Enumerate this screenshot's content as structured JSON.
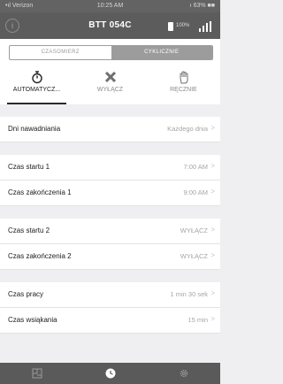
{
  "status_bar": {
    "carrier": "•ıl Verizon",
    "time": "10:25 AM",
    "battery": "ı 63% ■■"
  },
  "nav": {
    "info_symbol": "i",
    "title": "BTT 054C",
    "battery_percent": "100%"
  },
  "segments": {
    "left": "CZASOMIERZ",
    "right": "CYKLICZNIE",
    "selected": "CYKLICZNIE"
  },
  "modes": [
    {
      "label": "AUTOMATYCZ...",
      "icon": "stopwatch-icon",
      "active": true
    },
    {
      "label": "WYŁĄCZ",
      "icon": "x-close-icon",
      "active": false
    },
    {
      "label": "RĘCZNIE",
      "icon": "hand-icon",
      "active": false
    }
  ],
  "settings": {
    "days": {
      "label": "Dni nawadniania",
      "value": "Każdego dnia"
    },
    "start1": {
      "label": "Czas startu 1",
      "value": "7:00 AM"
    },
    "end1": {
      "label": "Czas zakończenia 1",
      "value": "9:00 AM"
    },
    "start2": {
      "label": "Czas startu 2",
      "value": "WYŁĄCZ"
    },
    "end2": {
      "label": "Czas zakończenia 2",
      "value": "WYŁĄCZ"
    },
    "run_time": {
      "label": "Czas pracy",
      "value": "1 min 30 sek"
    },
    "soak_time": {
      "label": "Czas wsiąkania",
      "value": "15 min"
    }
  },
  "chevron": ">",
  "tabs": [
    {
      "icon": "map-icon"
    },
    {
      "icon": "clock-icon",
      "active": true
    },
    {
      "icon": "gear-icon"
    }
  ]
}
